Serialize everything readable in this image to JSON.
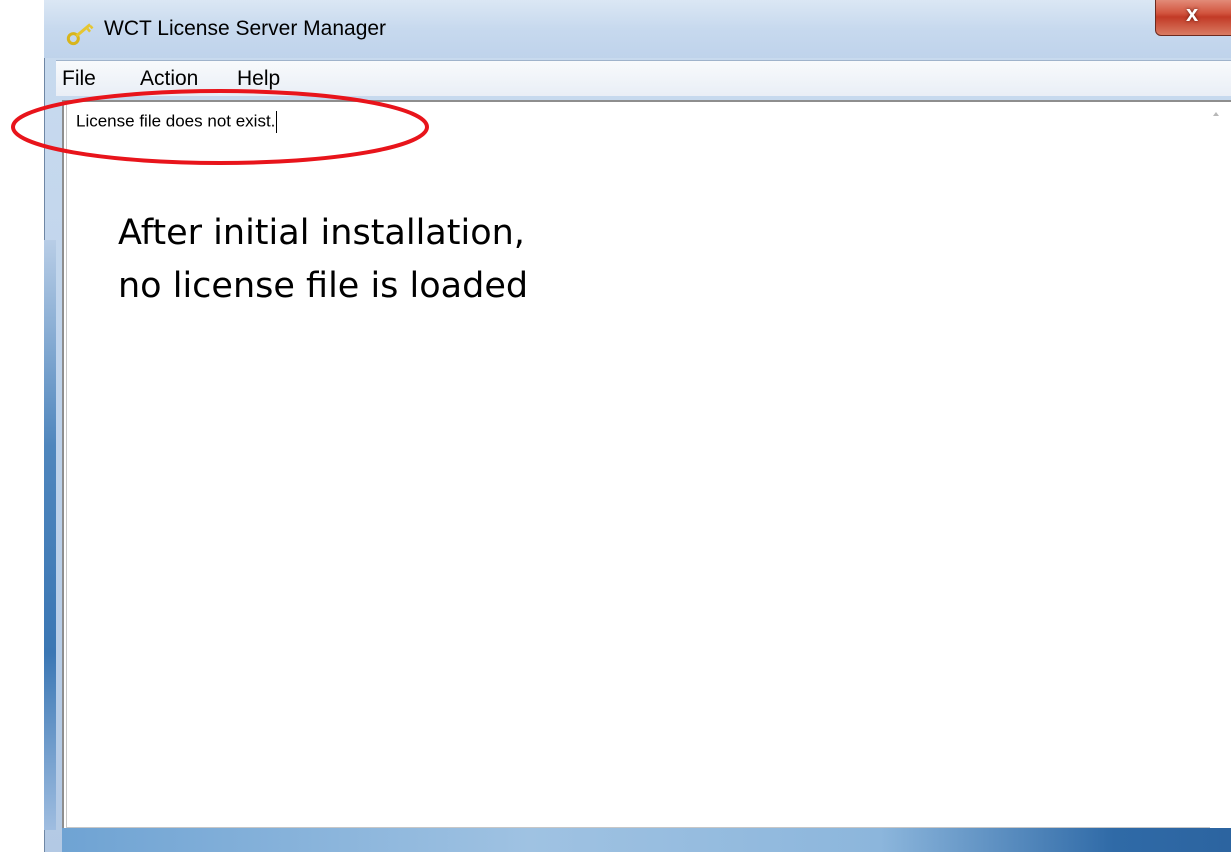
{
  "window": {
    "title": "WCT License Server Manager",
    "close_label": "x"
  },
  "icons": {
    "app": "key-icon",
    "close": "close-icon",
    "scroll_up": "scroll-up-arrow-icon"
  },
  "menu": {
    "items": [
      {
        "label": "File"
      },
      {
        "label": "Action"
      },
      {
        "label": "Help"
      }
    ]
  },
  "content": {
    "status_text": "License file does not exist."
  },
  "annotation": {
    "line1": "After initial installation,",
    "line2": "no license file is loaded",
    "highlight_color": "#e8141b"
  },
  "colors": {
    "titlebar": "#c7d9ee",
    "close_button": "#c23a26",
    "key_icon": "#e6c630"
  }
}
